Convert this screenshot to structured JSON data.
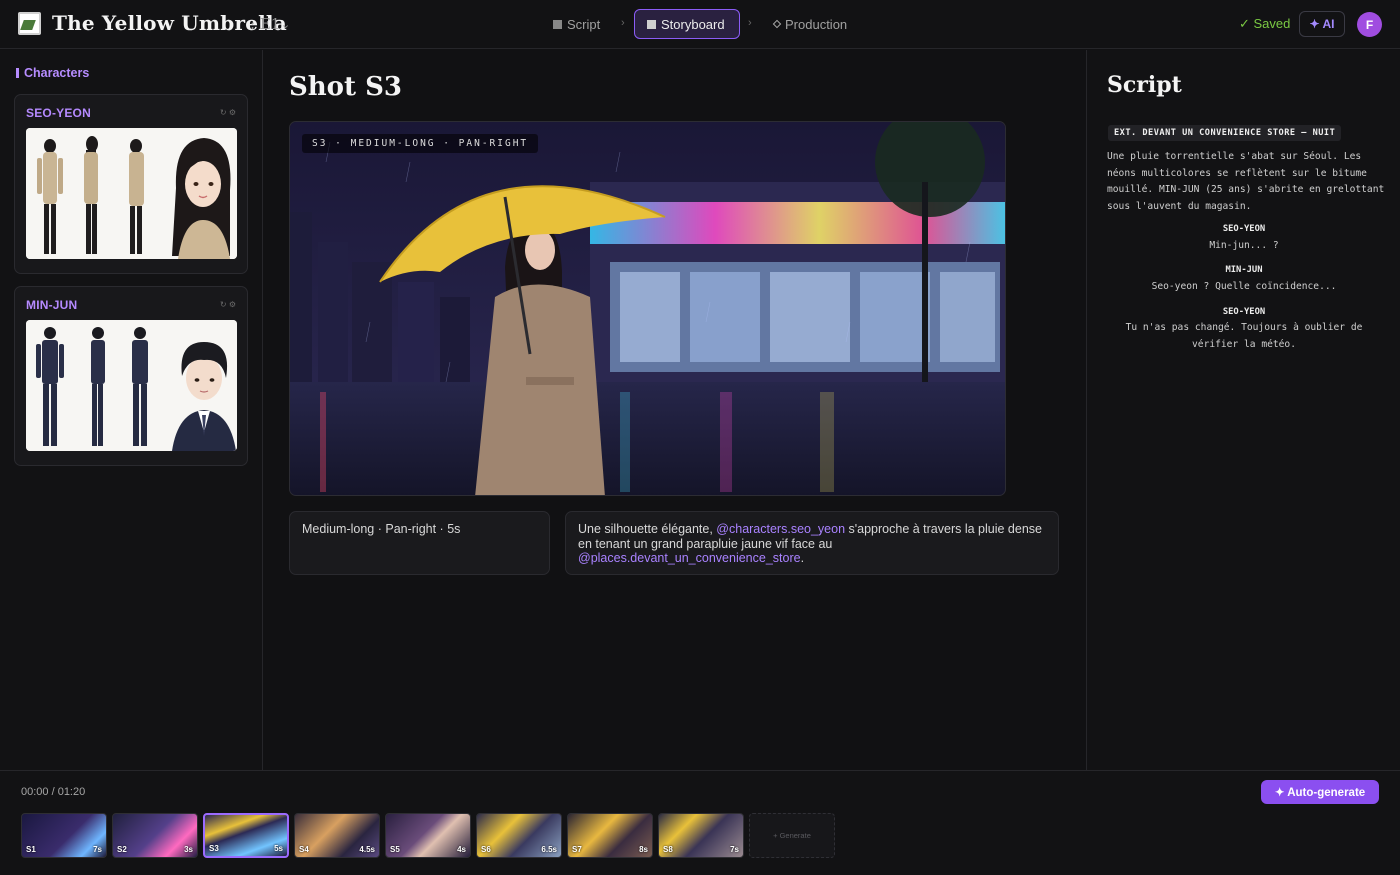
{
  "header": {
    "project_title": "The Yellow Umbrella",
    "episode": ": E1",
    "tabs": [
      {
        "label": "Script",
        "active": false
      },
      {
        "label": "Storyboard",
        "active": true
      },
      {
        "label": "Production",
        "active": false
      }
    ],
    "saved_label": "✓ Saved",
    "ai_label": "✦ AI",
    "avatar_initial": "F"
  },
  "sidebar": {
    "section_label": "Characters",
    "characters": [
      {
        "name": "SEO-YEON",
        "controls": "↻ ⚙"
      },
      {
        "name": "MIN-JUN",
        "controls": "↻ ⚙"
      }
    ]
  },
  "shot": {
    "title": "Shot S3",
    "frame_tag": "S3 · MEDIUM-LONG · PAN-RIGHT",
    "camera": "Medium-long · Pan-right · 5s",
    "description": {
      "part1": "Une silhouette élégante, ",
      "mention1": "@characters.seo_yeon",
      "part2": " s'approche à travers la pluie dense en tenant un grand parapluie jaune vif face au ",
      "mention2": "@places.devant_un_convenience_store",
      "part3": "."
    }
  },
  "script": {
    "title": "Script",
    "scene_heading": "EXT. DEVANT UN CONVENIENCE STORE — NUIT",
    "action": "Une pluie torrentielle s'abat sur Séoul. Les néons multicolores se reflètent sur le bitume mouillé. MIN-JUN (25 ans) s'abrite en grelottant sous l'auvent du magasin.",
    "dialogue": [
      {
        "cue": "SEO-YEON",
        "line": "Min-jun... ?"
      },
      {
        "cue": "MIN-JUN",
        "line": "Seo-yeon ? Quelle coïncidence..."
      },
      {
        "cue": "SEO-YEON",
        "line": "Tu n'as pas changé. Toujours à oublier de vérifier la météo."
      }
    ]
  },
  "timeline": {
    "timecode": "00:00 / 01:20",
    "autogen_label": "✦ Auto-generate",
    "generate_label": "+ Generate",
    "shots": [
      {
        "id": "S1",
        "duration": "7s",
        "active": false
      },
      {
        "id": "S2",
        "duration": "3s",
        "active": false
      },
      {
        "id": "S3",
        "duration": "5s",
        "active": true
      },
      {
        "id": "S4",
        "duration": "4.5s",
        "active": false
      },
      {
        "id": "S5",
        "duration": "4s",
        "active": false
      },
      {
        "id": "S6",
        "duration": "6.5s",
        "active": false
      },
      {
        "id": "S7",
        "duration": "8s",
        "active": false
      },
      {
        "id": "S8",
        "duration": "7s",
        "active": false
      }
    ]
  },
  "colors": {
    "accent": "#8b5cf6",
    "mention": "#a982ff",
    "saved": "#7ac943",
    "umbrella": "#e8c13a"
  }
}
